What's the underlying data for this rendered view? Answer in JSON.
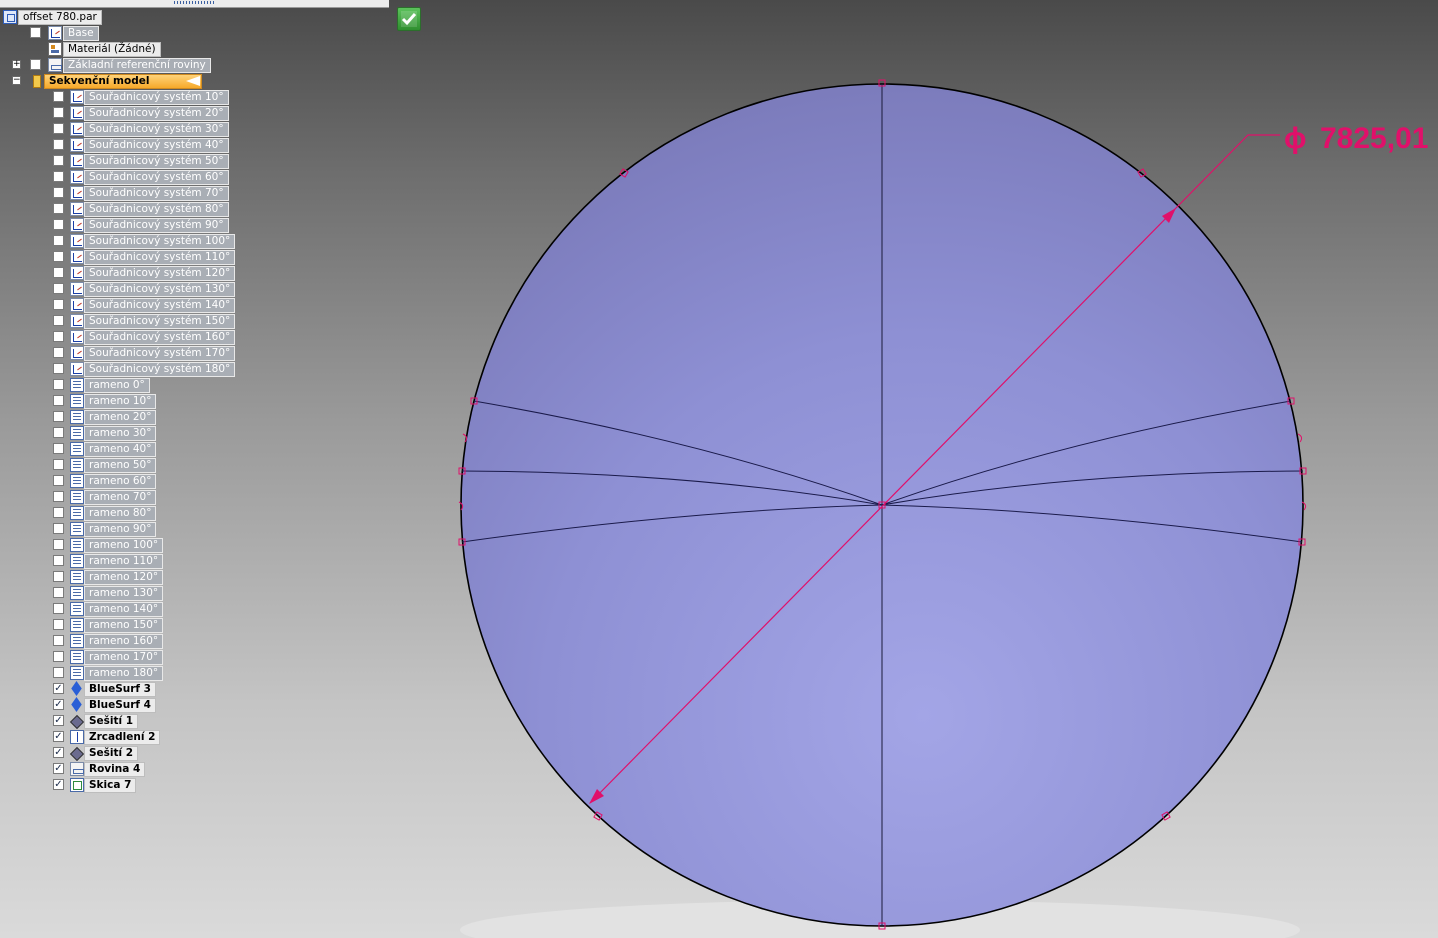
{
  "document": {
    "title": "offset 780.par"
  },
  "tree": {
    "base": "Base",
    "material": "Materiál (Žádné)",
    "ref_planes": "Základní referenční roviny",
    "seq_model": "Sekvenční model",
    "coord_systems": [
      "Souřadnicový systém 10°",
      "Souřadnicový systém 20°",
      "Souřadnicový systém 30°",
      "Souřadnicový systém 40°",
      "Souřadnicový systém 50°",
      "Souřadnicový systém 60°",
      "Souřadnicový systém 70°",
      "Souřadnicový systém 80°",
      "Souřadnicový systém 90°",
      "Souřadnicový systém 100°",
      "Souřadnicový systém 110°",
      "Souřadnicový systém 120°",
      "Souřadnicový systém 130°",
      "Souřadnicový systém 140°",
      "Souřadnicový systém 150°",
      "Souřadnicový systém 160°",
      "Souřadnicový systém 170°",
      "Souřadnicový systém 180°"
    ],
    "ramena": [
      "rameno 0°",
      "rameno 10°",
      "rameno 20°",
      "rameno 30°",
      "rameno 40°",
      "rameno 50°",
      "rameno 60°",
      "rameno 70°",
      "rameno 80°",
      "rameno 90°",
      "rameno 100°",
      "rameno 110°",
      "rameno 120°",
      "rameno 130°",
      "rameno 140°",
      "rameno 150°",
      "rameno 160°",
      "rameno 170°",
      "rameno 180°"
    ],
    "features": [
      {
        "label": "BlueSurf 3",
        "icon": "bluesurf-icon",
        "checked": true
      },
      {
        "label": "BlueSurf 4",
        "icon": "bluesurf-icon",
        "checked": true
      },
      {
        "label": "Sešití 1",
        "icon": "stitch-icon",
        "checked": true
      },
      {
        "label": "Zrcadlení 2",
        "icon": "mirror-icon",
        "checked": true
      },
      {
        "label": "Sešití 2",
        "icon": "stitch-icon",
        "checked": true
      },
      {
        "label": "Rovina 4",
        "icon": "plane-icon",
        "checked": true
      },
      {
        "label": "Skica 7",
        "icon": "sketch-icon",
        "checked": true
      }
    ]
  },
  "dimension": {
    "symbol": "ϕ",
    "value": "7825,01"
  },
  "colors": {
    "surface_fill": "#8c8cd0",
    "dimension": "#e0106a",
    "active_node": "#f6a92a"
  }
}
